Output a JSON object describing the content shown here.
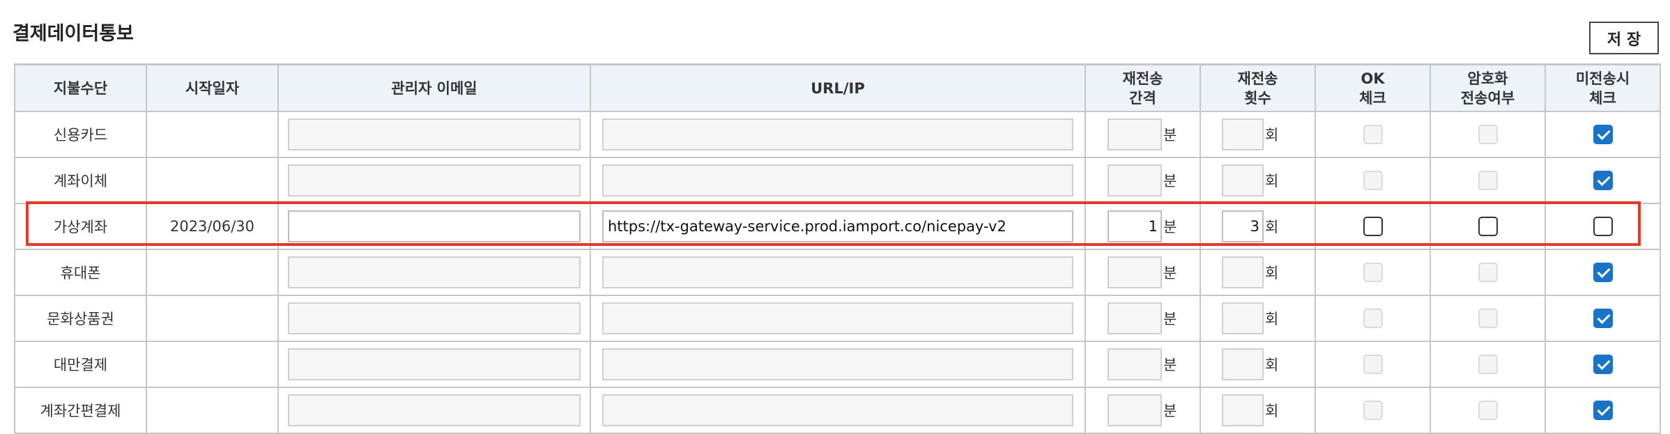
{
  "page": {
    "title": "결제데이터통보",
    "save_label": "저 장"
  },
  "columns": [
    "지불수단",
    "시작일자",
    "관리자 이메일",
    "URL/IP",
    "재전송\n간격",
    "재전송\n횟수",
    "OK\n체크",
    "암호화\n전송여부",
    "미전송시\n체크"
  ],
  "units": {
    "interval": "분",
    "count": "회"
  },
  "rows": [
    {
      "method": "신용카드",
      "start_date": "",
      "email": "",
      "url": "",
      "interval": "",
      "count": "",
      "ok_check": "disabled",
      "encrypt": "disabled",
      "unsent_check": "checked"
    },
    {
      "method": "계좌이체",
      "start_date": "",
      "email": "",
      "url": "",
      "interval": "",
      "count": "",
      "ok_check": "disabled",
      "encrypt": "disabled",
      "unsent_check": "checked"
    },
    {
      "method": "가상계좌",
      "start_date": "2023/06/30",
      "email": "",
      "url": "https://tx-gateway-service.prod.iamport.co/nicepay-v2",
      "interval": "1",
      "count": "3",
      "ok_check": "unchecked",
      "encrypt": "unchecked",
      "unsent_check": "unchecked"
    },
    {
      "method": "휴대폰",
      "start_date": "",
      "email": "",
      "url": "",
      "interval": "",
      "count": "",
      "ok_check": "disabled",
      "encrypt": "disabled",
      "unsent_check": "checked"
    },
    {
      "method": "문화상품권",
      "start_date": "",
      "email": "",
      "url": "",
      "interval": "",
      "count": "",
      "ok_check": "disabled",
      "encrypt": "disabled",
      "unsent_check": "checked"
    },
    {
      "method": "대만결제",
      "start_date": "",
      "email": "",
      "url": "",
      "interval": "",
      "count": "",
      "ok_check": "disabled",
      "encrypt": "disabled",
      "unsent_check": "checked"
    },
    {
      "method": "계좌간편결제",
      "start_date": "",
      "email": "",
      "url": "",
      "interval": "",
      "count": "",
      "ok_check": "disabled",
      "encrypt": "disabled",
      "unsent_check": "checked"
    }
  ],
  "colors": {
    "header_bg": "#eef2f9",
    "checkbox_checked": "#1a73c7",
    "highlight_border": "#e03a2b"
  }
}
